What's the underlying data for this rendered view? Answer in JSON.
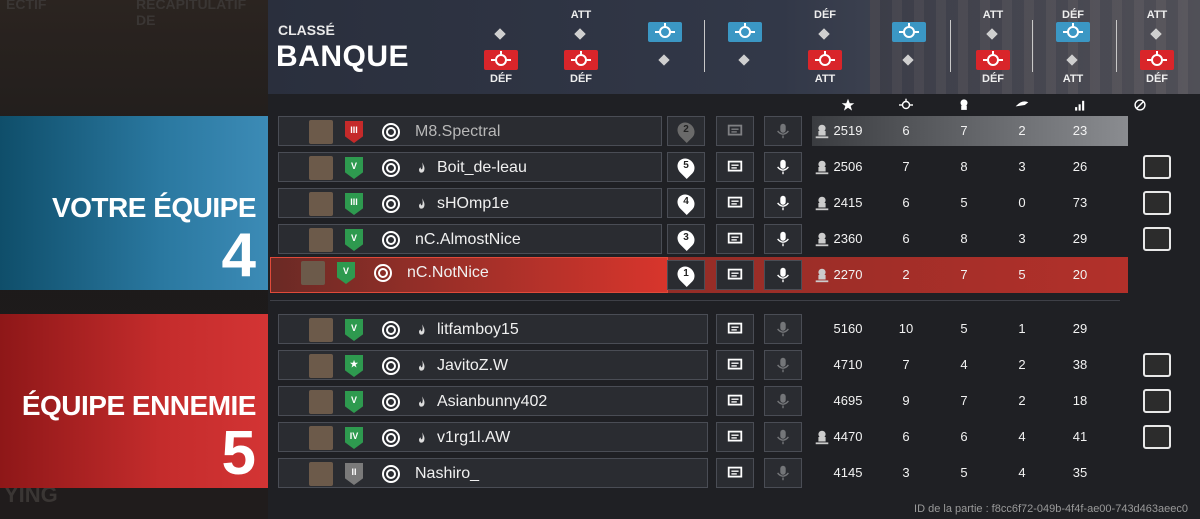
{
  "header": {
    "mode": "CLASSÉ",
    "map": "BANQUE",
    "left_ghost": [
      "ECTIF",
      "RÉCAPITULATIF DE",
      "YING"
    ],
    "rounds": [
      {
        "top": "",
        "chip": "red",
        "bottom": "DÉF"
      },
      {
        "top": "ATT",
        "chip": "red",
        "bottom": "DÉF"
      },
      {
        "top": "",
        "chip": "blue",
        "bottom": ""
      },
      {
        "top": "",
        "chip": "blue",
        "bottom": ""
      },
      {
        "top": "DÉF",
        "chip": "red",
        "bottom": "ATT"
      },
      {
        "top": "",
        "chip": "blue",
        "bottom": ""
      },
      {
        "top": "ATT",
        "chip": "red",
        "bottom": "DÉF"
      },
      {
        "top": "DÉF",
        "chip": "blue",
        "bottom": "ATT"
      },
      {
        "top": "ATT",
        "chip": "red",
        "bottom": "DÉF"
      }
    ]
  },
  "stat_headers": [
    "star-icon",
    "target-icon",
    "skull-icon",
    "wing-icon",
    "signal-icon",
    "ban-icon"
  ],
  "ally_team": {
    "label": "VOTRE ÉQUIPE",
    "score": "4",
    "players": [
      {
        "name": "M8.Spectral",
        "rank": "III",
        "rank_color": "red",
        "ping_num": "2",
        "score": "2519",
        "kills": "6",
        "deaths": "7",
        "assists": "2",
        "ping": "23",
        "flame": false,
        "dim": true,
        "highlight": false,
        "badge": ""
      },
      {
        "name": "Boit_de-leau",
        "rank": "V",
        "rank_color": "green",
        "ping_num": "5",
        "score": "2506",
        "kills": "7",
        "deaths": "8",
        "assists": "3",
        "ping": "26",
        "flame": true,
        "dim": false,
        "highlight": false,
        "badge": "eye-badge"
      },
      {
        "name": "sHOmp1e",
        "rank": "III",
        "rank_color": "green",
        "ping_num": "4",
        "score": "2415",
        "kills": "6",
        "deaths": "5",
        "assists": "0",
        "ping": "73",
        "flame": true,
        "dim": false,
        "highlight": false,
        "badge": "stripe-badge"
      },
      {
        "name": "nC.AlmostNice",
        "rank": "V",
        "rank_color": "green",
        "ping_num": "3",
        "score": "2360",
        "kills": "6",
        "deaths": "8",
        "assists": "3",
        "ping": "29",
        "flame": false,
        "dim": false,
        "highlight": false,
        "badge": "medic-badge"
      },
      {
        "name": "nC.NotNice",
        "rank": "V",
        "rank_color": "green",
        "ping_num": "1",
        "score": "2270",
        "kills": "2",
        "deaths": "7",
        "assists": "5",
        "ping": "20",
        "flame": false,
        "dim": false,
        "highlight": true,
        "badge": ""
      }
    ]
  },
  "enemy_team": {
    "label": "ÉQUIPE ENNEMIE",
    "score": "5",
    "players": [
      {
        "name": "litfamboy15",
        "rank": "V",
        "rank_color": "green",
        "score": "5160",
        "kills": "10",
        "deaths": "5",
        "assists": "1",
        "ping": "29",
        "flame": true,
        "dead": false,
        "badge": ""
      },
      {
        "name": "JavitoZ.W",
        "rank": "★",
        "rank_color": "green",
        "score": "4710",
        "kills": "7",
        "deaths": "4",
        "assists": "2",
        "ping": "38",
        "flame": true,
        "dead": false,
        "badge": "wolf-badge"
      },
      {
        "name": "Asianbunny402",
        "rank": "V",
        "rank_color": "green",
        "score": "4695",
        "kills": "9",
        "deaths": "7",
        "assists": "2",
        "ping": "18",
        "flame": true,
        "dead": false,
        "badge": "splat-badge"
      },
      {
        "name": "v1rg1l.AW",
        "rank": "IV",
        "rank_color": "green",
        "score": "4470",
        "kills": "6",
        "deaths": "6",
        "assists": "4",
        "ping": "41",
        "flame": true,
        "dead": true,
        "badge": "skull-badge"
      },
      {
        "name": "Nashiro_",
        "rank": "II",
        "rank_color": "grey",
        "score": "4145",
        "kills": "3",
        "deaths": "5",
        "assists": "4",
        "ping": "35",
        "flame": false,
        "dead": false,
        "badge": ""
      }
    ]
  },
  "footer": {
    "match_id": "ID de la partie : f8cc6f72-049b-4f4f-ae00-743d463aeec0"
  }
}
